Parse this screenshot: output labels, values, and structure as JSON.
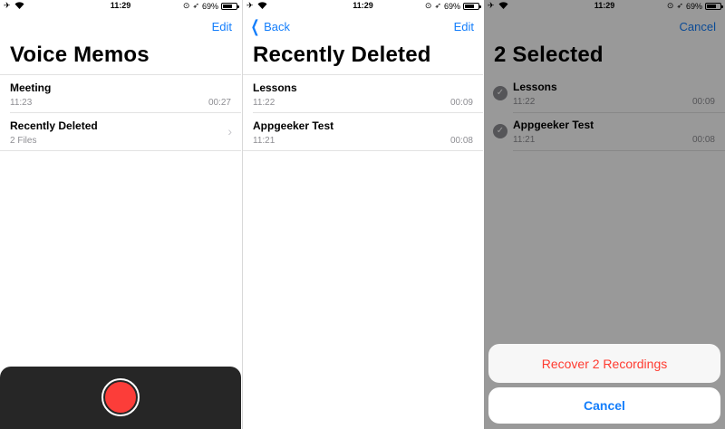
{
  "status": {
    "time": "11:29",
    "battery_text": "69%",
    "battery_level": 0.69
  },
  "panel1": {
    "nav_right": "Edit",
    "title": "Voice Memos",
    "rows": [
      {
        "title": "Meeting",
        "subtitle": "11:23",
        "duration": "00:27"
      },
      {
        "title": "Recently Deleted",
        "subtitle": "2 Files"
      }
    ]
  },
  "panel2": {
    "nav_left": "Back",
    "nav_right": "Edit",
    "title": "Recently Deleted",
    "rows": [
      {
        "title": "Lessons",
        "subtitle": "11:22",
        "duration": "00:09"
      },
      {
        "title": "Appgeeker Test",
        "subtitle": "11:21",
        "duration": "00:08"
      }
    ]
  },
  "panel3": {
    "nav_right": "Cancel",
    "title": "2 Selected",
    "rows": [
      {
        "title": "Lessons",
        "subtitle": "11:22",
        "duration": "00:09"
      },
      {
        "title": "Appgeeker Test",
        "subtitle": "11:21",
        "duration": "00:08"
      }
    ],
    "action_recover": "Recover 2 Recordings",
    "action_cancel": "Cancel"
  },
  "colors": {
    "tint": "#147efb",
    "record": "#fc3d39",
    "destructive": "#ff3b30"
  }
}
